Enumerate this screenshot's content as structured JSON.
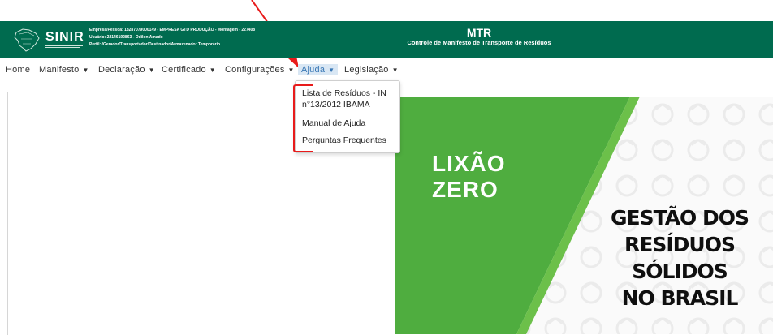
{
  "header": {
    "logo": "SINIR",
    "user_lines": [
      "Empresa/Pessoa: 18287079000149 - EMPRESA GTD PRODUÇÃO - Montagem - 227408",
      "Usuário: 22146192863 - Odilon Amado",
      "Perfil: /Gerador/Transportador/Destinador/Armazenador Temporário"
    ],
    "app_title": "MTR",
    "app_subtitle": "Controle de Manifesto de Transporte de Resíduos"
  },
  "nav": {
    "items": [
      {
        "label": "Home",
        "caret": false
      },
      {
        "label": "Manifesto",
        "caret": true
      },
      {
        "label": "Declaração",
        "caret": true
      },
      {
        "label": "Certificado",
        "caret": true
      },
      {
        "label": "Configurações",
        "caret": true
      },
      {
        "label": "Ajuda",
        "caret": true,
        "active": true
      },
      {
        "label": "Legislação",
        "caret": true
      }
    ],
    "caret_glyph": "▼"
  },
  "dropdown": {
    "items": [
      "Lista de Resíduos - IN",
      "n°13/2012 IBAMA",
      "Manual de Ajuda",
      "Perguntas Frequentes"
    ]
  },
  "banner": {
    "left_text": [
      "LIXÃO",
      "ZERO"
    ],
    "right_text": [
      "GESTÃO DOS",
      "RESÍDUOS",
      "SÓLIDOS",
      "NO BRASIL"
    ]
  },
  "colors": {
    "header_bg": "#006b4f",
    "banner_green": "#4fad3f",
    "annotation_red": "#e81b1b",
    "active_tab": "#3a78b5"
  }
}
